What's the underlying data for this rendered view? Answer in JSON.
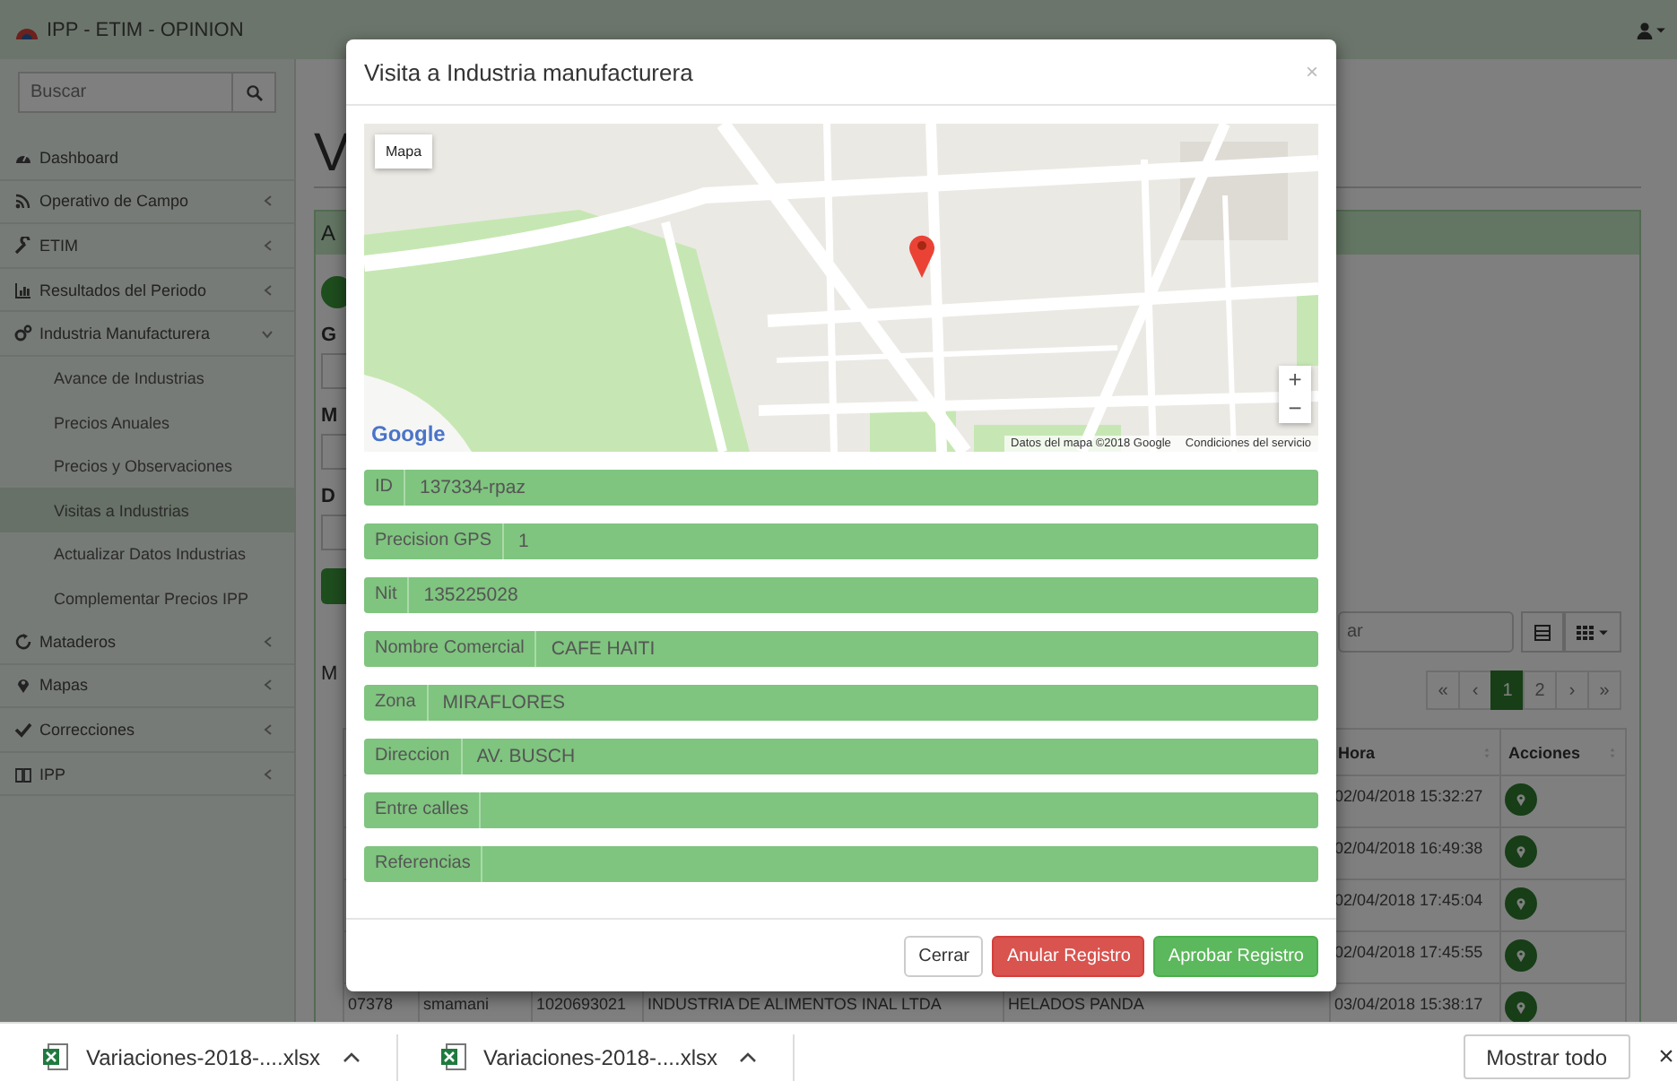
{
  "header": {
    "title": "IPP - ETIM - OPINION"
  },
  "sidebar": {
    "search_placeholder": "Buscar",
    "items": [
      {
        "label": "Dashboard",
        "kind": "link"
      },
      {
        "label": "Operativo de Campo",
        "kind": "menu",
        "expanded": false
      },
      {
        "label": "ETIM",
        "kind": "menu",
        "expanded": false
      },
      {
        "label": "Resultados del Periodo",
        "kind": "menu",
        "expanded": false
      },
      {
        "label": "Industria Manufacturera",
        "kind": "menu",
        "expanded": true,
        "children": [
          {
            "label": "Avance de Industrias",
            "selected": false
          },
          {
            "label": "Precios Anuales",
            "selected": false
          },
          {
            "label": "Precios y Observaciones",
            "selected": false
          },
          {
            "label": "Visitas a Industrias",
            "selected": true
          },
          {
            "label": "Actualizar Datos Industrias",
            "selected": false
          },
          {
            "label": "Complementar Precios IPP",
            "selected": false
          }
        ]
      },
      {
        "label": "Mataderos",
        "kind": "menu",
        "expanded": false
      },
      {
        "label": "Mapas",
        "kind": "menu",
        "expanded": false
      },
      {
        "label": "Correcciones",
        "kind": "menu",
        "expanded": false
      },
      {
        "label": "IPP",
        "kind": "menu",
        "expanded": false
      }
    ]
  },
  "page": {
    "heading": "V",
    "panel_title": "A",
    "form_labels": [
      "G",
      "M",
      "D"
    ],
    "list_label": "M"
  },
  "table": {
    "search_placeholder": "ar",
    "pagination": [
      {
        "label": "«",
        "selected": false
      },
      {
        "label": "‹",
        "selected": false
      },
      {
        "label": "1",
        "selected": true
      },
      {
        "label": "2",
        "selected": false
      },
      {
        "label": "›",
        "selected": false
      },
      {
        "label": "»",
        "selected": false
      }
    ],
    "columns": [
      "Hora",
      "Acciones"
    ],
    "rows": [
      {
        "hora": "02/04/2018 15:32:27"
      },
      {
        "hora": "02/04/2018 16:49:38"
      },
      {
        "hora": "02/04/2018 17:45:04"
      },
      {
        "hora": "02/04/2018 17:45:55"
      },
      {
        "cells": [
          "07378",
          "smamani",
          "1020693021",
          "INDUSTRIA DE ALIMENTOS INAL LTDA",
          "HELADOS PANDA"
        ],
        "hora": "03/04/2018 15:38:17"
      }
    ]
  },
  "modal": {
    "title": "Visita a Industria manufacturera",
    "close": "×",
    "map": {
      "type_button": "Mapa",
      "zoom_in": "+",
      "zoom_out": "−",
      "logo": "Google",
      "attribution": "Datos del mapa ©2018 Google",
      "terms": "Condiciones del servicio"
    },
    "fields": [
      {
        "label": "ID",
        "value": "137334-rpaz"
      },
      {
        "label": "Precision GPS",
        "value": "1"
      },
      {
        "label": "Nit",
        "value": "135225028"
      },
      {
        "label": "Nombre Comercial",
        "value": "CAFE HAITI"
      },
      {
        "label": "Zona",
        "value": "MIRAFLORES"
      },
      {
        "label": "Direccion",
        "value": "AV. BUSCH"
      },
      {
        "label": "Entre calles"
      },
      {
        "label": "Referencias"
      }
    ],
    "buttons": [
      {
        "label": "Cerrar",
        "kind": "default"
      },
      {
        "label": "Anular Registro",
        "kind": "danger"
      },
      {
        "label": "Aprobar Registro",
        "kind": "success"
      }
    ]
  },
  "downloads": {
    "items": [
      {
        "name": "Variaciones-2018-....xlsx"
      },
      {
        "name": "Variaciones-2018-....xlsx"
      }
    ],
    "show_all": "Mostrar todo",
    "close": "×"
  }
}
